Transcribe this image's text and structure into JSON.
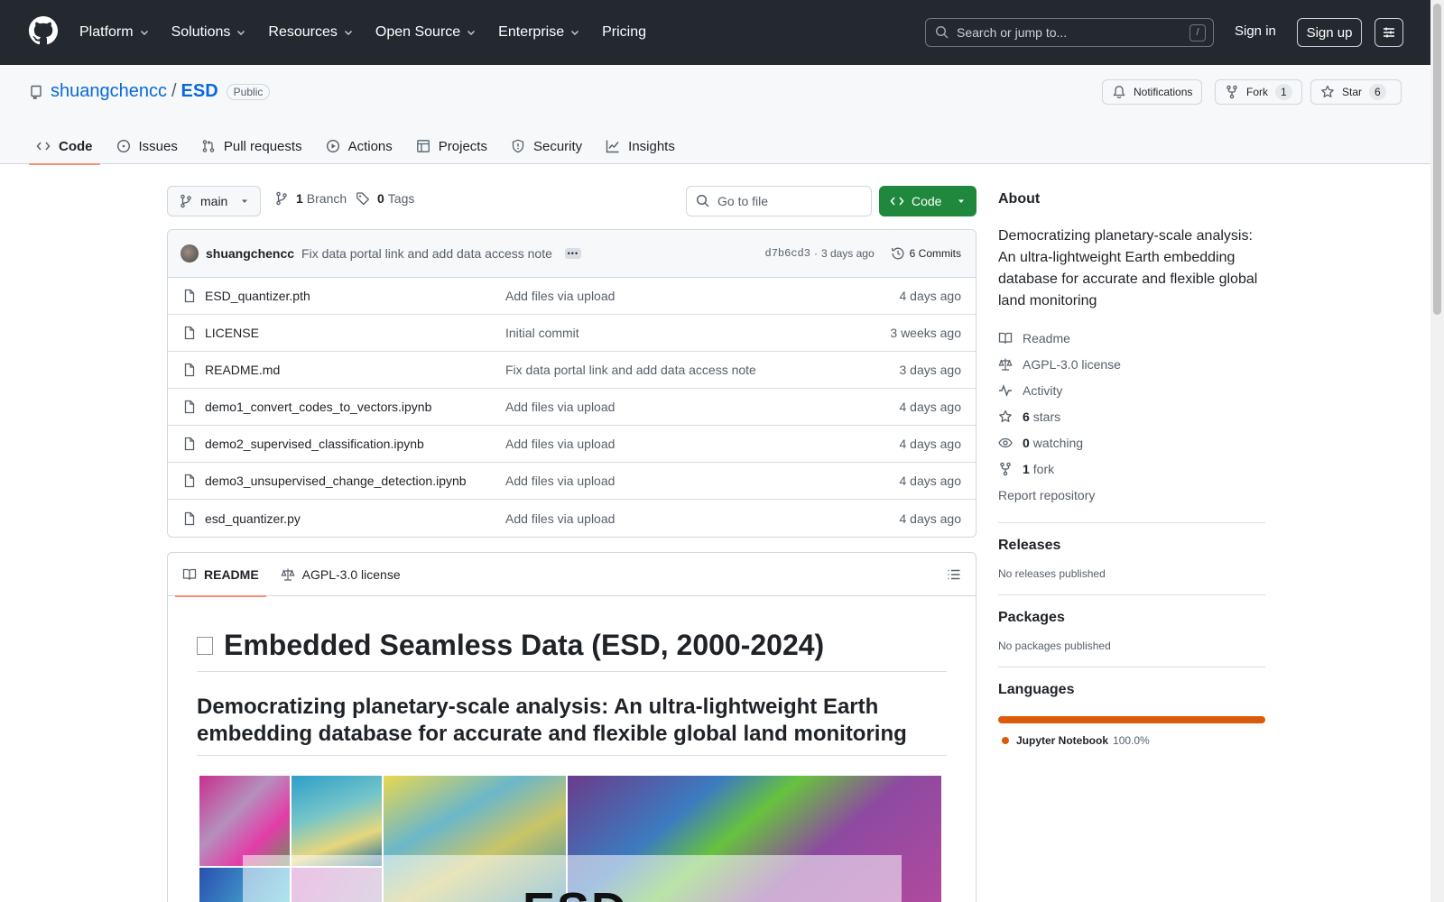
{
  "header": {
    "nav": [
      {
        "label": "Platform",
        "dropdown": true
      },
      {
        "label": "Solutions",
        "dropdown": true
      },
      {
        "label": "Resources",
        "dropdown": true
      },
      {
        "label": "Open Source",
        "dropdown": true
      },
      {
        "label": "Enterprise",
        "dropdown": true
      },
      {
        "label": "Pricing",
        "dropdown": false
      }
    ],
    "search_placeholder": "Search or jump to...",
    "search_shortcut": "/",
    "sign_in": "Sign in",
    "sign_up": "Sign up"
  },
  "repo": {
    "owner": "shuangchencc",
    "separator": "/",
    "name": "ESD",
    "visibility": "Public",
    "notifications_label": "Notifications",
    "fork_label": "Fork",
    "fork_count": "1",
    "star_label": "Star",
    "star_count": "6"
  },
  "tabs": [
    {
      "label": "Code",
      "icon": "code-icon",
      "active": true
    },
    {
      "label": "Issues",
      "icon": "issue-icon",
      "active": false
    },
    {
      "label": "Pull requests",
      "icon": "pull-request-icon",
      "active": false
    },
    {
      "label": "Actions",
      "icon": "play-icon",
      "active": false
    },
    {
      "label": "Projects",
      "icon": "table-icon",
      "active": false
    },
    {
      "label": "Security",
      "icon": "shield-icon",
      "active": false
    },
    {
      "label": "Insights",
      "icon": "graph-icon",
      "active": false
    }
  ],
  "branch_bar": {
    "branch": "main",
    "branch_count": "1",
    "branch_label": "Branch",
    "tag_count": "0",
    "tag_label": "Tags",
    "goto_placeholder": "Go to file",
    "code_button": "Code"
  },
  "commit": {
    "author": "shuangchencc",
    "message": "Fix data portal link and add data access note",
    "hash": "d7b6cd3",
    "separator": "·",
    "time": "3 days ago",
    "commits_label": "6 Commits"
  },
  "files": [
    {
      "name": "ESD_quantizer.pth",
      "message": "Add files via upload",
      "date": "4 days ago"
    },
    {
      "name": "LICENSE",
      "message": "Initial commit",
      "date": "3 weeks ago"
    },
    {
      "name": "README.md",
      "message": "Fix data portal link and add data access note",
      "date": "3 days ago"
    },
    {
      "name": "demo1_convert_codes_to_vectors.ipynb",
      "message": "Add files via upload",
      "date": "4 days ago"
    },
    {
      "name": "demo2_supervised_classification.ipynb",
      "message": "Add files via upload",
      "date": "4 days ago"
    },
    {
      "name": "demo3_unsupervised_change_detection.ipynb",
      "message": "Add files via upload",
      "date": "4 days ago"
    },
    {
      "name": "esd_quantizer.py",
      "message": "Add files via upload",
      "date": "4 days ago"
    }
  ],
  "readme": {
    "tab_readme": "README",
    "tab_license": "AGPL-3.0 license",
    "h1": "Embedded Seamless Data (ESD, 2000-2024)",
    "h2": "Democratizing planetary-scale analysis: An ultra-lightweight Earth embedding database for accurate and flexible global land monitoring",
    "hero_text": "ESD"
  },
  "sidebar": {
    "about_title": "About",
    "about_text": "Democratizing planetary-scale analysis: An ultra-lightweight Earth embedding database for accurate and flexible global land monitoring",
    "readme": "Readme",
    "license": "AGPL-3.0 license",
    "activity": "Activity",
    "stars_count": "6",
    "stars_label": "stars",
    "watching_count": "0",
    "watching_label": "watching",
    "forks_count": "1",
    "forks_label": "fork",
    "report": "Report repository",
    "releases_title": "Releases",
    "releases_text": "No releases published",
    "packages_title": "Packages",
    "packages_text": "No packages published",
    "languages_title": "Languages",
    "language_name": "Jupyter Notebook",
    "language_pct": "100.0%",
    "language_color": "#da5b0b"
  },
  "colors": {
    "header_bg": "#24292f",
    "accent_blue": "#0969da",
    "code_button_green": "#1f883d",
    "active_tab_underline": "#fd8c73"
  }
}
